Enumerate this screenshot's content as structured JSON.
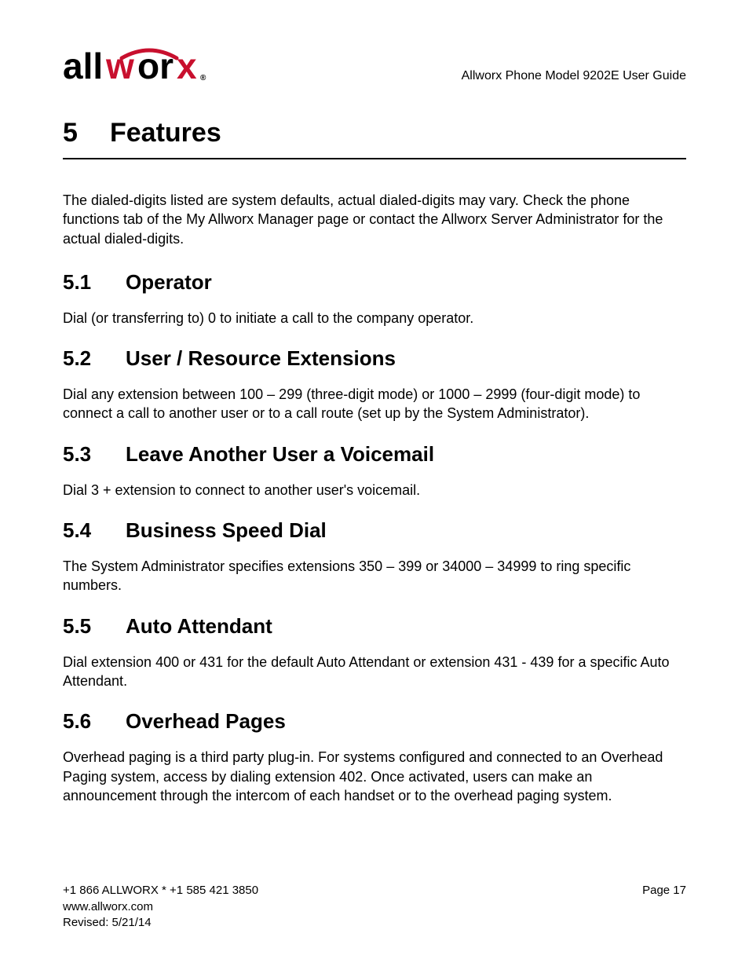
{
  "header": {
    "logo_text": "allworx",
    "doc_title": "Allworx Phone Model 9202E User Guide"
  },
  "chapter": {
    "number": "5",
    "title": "Features"
  },
  "intro": "The dialed-digits listed are system defaults, actual dialed-digits may vary. Check the phone functions tab of the My Allworx Manager page or contact the Allworx Server Administrator for the actual dialed-digits.",
  "sections": [
    {
      "number": "5.1",
      "title": "Operator",
      "body": "Dial (or transferring to) 0 to initiate a call to the company operator."
    },
    {
      "number": "5.2",
      "title": "User / Resource Extensions",
      "body": "Dial any extension between 100 – 299 (three-digit mode) or 1000 – 2999 (four-digit mode) to connect a call to another user or to a call route (set up by the System Administrator)."
    },
    {
      "number": "5.3",
      "title": "Leave Another User a Voicemail",
      "body": "Dial 3 + extension to connect to another user's voicemail."
    },
    {
      "number": "5.4",
      "title": "Business Speed Dial",
      "body": "The System Administrator specifies extensions 350 – 399 or 34000 – 34999 to ring specific numbers."
    },
    {
      "number": "5.5",
      "title": "Auto Attendant",
      "body": "Dial extension 400 or 431 for the default Auto Attendant or extension 431 - 439 for a specific Auto Attendant."
    },
    {
      "number": "5.6",
      "title": "Overhead Pages",
      "body": "Overhead paging is a third party plug-in. For systems configured and connected to an Overhead Paging system, access by dialing extension 402. Once activated, users can make an announcement through the intercom of each handset or to the overhead paging system."
    }
  ],
  "footer": {
    "phone": "+1 866 ALLWORX * +1 585 421 3850",
    "page": "Page 17",
    "website": "www.allworx.com",
    "revised": "Revised: 5/21/14"
  }
}
